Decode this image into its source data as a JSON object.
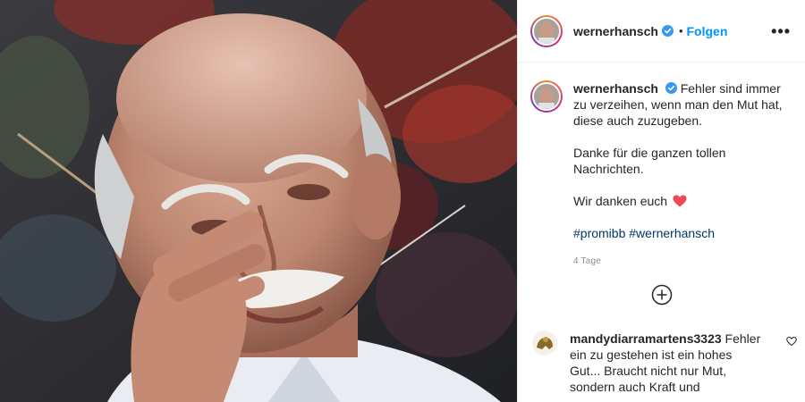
{
  "header": {
    "username": "wernerhansch",
    "separator": "•",
    "follow_label": "Folgen",
    "more_label": "•••",
    "verified_icon": "verified-badge-icon"
  },
  "caption": {
    "username": "wernerhansch",
    "paragraphs": [
      "Fehler sind immer zu verzeihen, wenn man den Mut hat, diese auch zuzugeben.",
      "Danke für die ganzen tollen Nachrichten.",
      "Wir danken euch"
    ],
    "hashtags": [
      "#promibb",
      "#wernerhansch"
    ],
    "timestamp": "4 Tage"
  },
  "comments": [
    {
      "username": "mandydiarramartens3323",
      "text": "Fehler ein zu gestehen ist ein hohes Gut... Braucht nicht nur Mut, sondern auch Kraft und"
    }
  ],
  "colors": {
    "link": "#0095f6",
    "hashtag": "#00376b",
    "verified": "#3897f0",
    "heart": "#ed4956",
    "muted": "#8e8e8e"
  }
}
